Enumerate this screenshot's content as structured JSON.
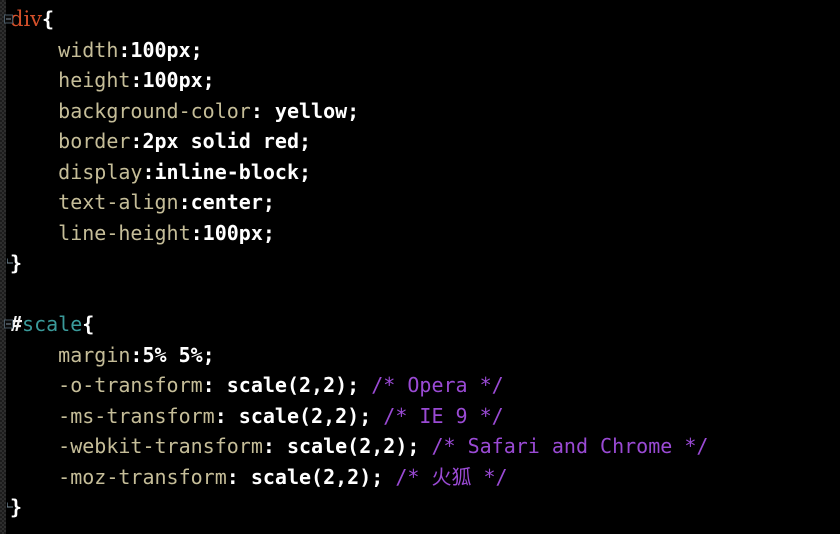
{
  "editor": {
    "background_color": "#000000",
    "gutter_color": "#1c1c1c",
    "language": "CSS",
    "colors": {
      "selector_tag": "#d4502a",
      "selector_id": "#3a9a9a",
      "property": "#c5bd98",
      "value": "#ffffff",
      "comment": "#9a4ad4",
      "punctuation": "#ffffff"
    }
  },
  "code": {
    "lines": [
      {
        "id": "line-1",
        "marker": "fold-open",
        "tokens": [
          {
            "kind": "selector-tag",
            "text": "div"
          },
          {
            "kind": "brace",
            "text": "{"
          }
        ]
      },
      {
        "id": "line-2",
        "marker": "none",
        "tokens": [
          {
            "kind": "property",
            "text": "    width"
          },
          {
            "kind": "punct",
            "text": ":"
          },
          {
            "kind": "value",
            "text": "100px;"
          }
        ]
      },
      {
        "id": "line-3",
        "marker": "none",
        "tokens": [
          {
            "kind": "property",
            "text": "    height"
          },
          {
            "kind": "punct",
            "text": ":"
          },
          {
            "kind": "value",
            "text": "100px;"
          }
        ]
      },
      {
        "id": "line-4",
        "marker": "none",
        "tokens": [
          {
            "kind": "property",
            "text": "    background-color"
          },
          {
            "kind": "punct",
            "text": ": "
          },
          {
            "kind": "value",
            "text": "yellow;"
          }
        ]
      },
      {
        "id": "line-5",
        "marker": "none",
        "tokens": [
          {
            "kind": "property",
            "text": "    border"
          },
          {
            "kind": "punct",
            "text": ":"
          },
          {
            "kind": "value",
            "text": "2px solid red;"
          }
        ]
      },
      {
        "id": "line-6",
        "marker": "none",
        "tokens": [
          {
            "kind": "property",
            "text": "    display"
          },
          {
            "kind": "punct",
            "text": ":"
          },
          {
            "kind": "value",
            "text": "inline-block;"
          }
        ]
      },
      {
        "id": "line-7",
        "marker": "none",
        "tokens": [
          {
            "kind": "property",
            "text": "    text-align"
          },
          {
            "kind": "punct",
            "text": ":"
          },
          {
            "kind": "value",
            "text": "center;"
          }
        ]
      },
      {
        "id": "line-8",
        "marker": "none",
        "tokens": [
          {
            "kind": "property",
            "text": "    line-height"
          },
          {
            "kind": "punct",
            "text": ":"
          },
          {
            "kind": "value",
            "text": "100px;"
          }
        ]
      },
      {
        "id": "line-9",
        "marker": "fold-end",
        "tokens": [
          {
            "kind": "brace",
            "text": "}"
          }
        ]
      },
      {
        "id": "line-10",
        "marker": "none",
        "tokens": []
      },
      {
        "id": "line-11",
        "marker": "fold-open",
        "tokens": [
          {
            "kind": "hash",
            "text": "#"
          },
          {
            "kind": "selector-id",
            "text": "scale"
          },
          {
            "kind": "brace",
            "text": "{"
          }
        ]
      },
      {
        "id": "line-12",
        "marker": "none",
        "tokens": [
          {
            "kind": "property",
            "text": "    margin"
          },
          {
            "kind": "punct",
            "text": ":"
          },
          {
            "kind": "value",
            "text": "5% 5%;"
          }
        ]
      },
      {
        "id": "line-13",
        "marker": "none",
        "tokens": [
          {
            "kind": "property",
            "text": "    -o-transform"
          },
          {
            "kind": "punct",
            "text": ": "
          },
          {
            "kind": "value",
            "text": "scale(2,2); "
          },
          {
            "kind": "comment",
            "text": "/* Opera */"
          }
        ]
      },
      {
        "id": "line-14",
        "marker": "none",
        "tokens": [
          {
            "kind": "property",
            "text": "    -ms-transform"
          },
          {
            "kind": "punct",
            "text": ": "
          },
          {
            "kind": "value",
            "text": "scale(2,2); "
          },
          {
            "kind": "comment",
            "text": "/* IE 9 */"
          }
        ]
      },
      {
        "id": "line-15",
        "marker": "none",
        "tokens": [
          {
            "kind": "property",
            "text": "    -webkit-transform"
          },
          {
            "kind": "punct",
            "text": ": "
          },
          {
            "kind": "value",
            "text": "scale(2,2); "
          },
          {
            "kind": "comment",
            "text": "/* Safari and Chrome */"
          }
        ]
      },
      {
        "id": "line-16",
        "marker": "none",
        "tokens": [
          {
            "kind": "property",
            "text": "    -moz-transform"
          },
          {
            "kind": "punct",
            "text": ": "
          },
          {
            "kind": "value",
            "text": "scale(2,2); "
          },
          {
            "kind": "comment",
            "text": "/* 火狐 */"
          }
        ]
      },
      {
        "id": "line-17",
        "marker": "fold-end",
        "tokens": [
          {
            "kind": "brace",
            "text": "}"
          }
        ]
      }
    ]
  }
}
